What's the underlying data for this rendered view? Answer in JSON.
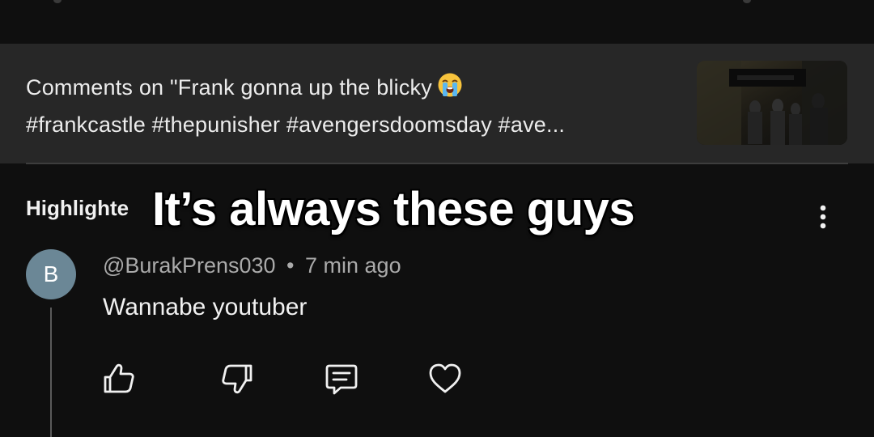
{
  "video": {
    "comments_title_line1": "Comments on \"Frank gonna up the blicky",
    "comments_title_line2": "#frankcastle #thepunisher #avengersdoomsday #ave...",
    "emoji_name": "loudly-crying-face-emoji"
  },
  "section": {
    "label": "Highlighte"
  },
  "overlay": {
    "caption": "It’s always these guys"
  },
  "comment": {
    "avatar_letter": "B",
    "author": "@BurakPrens030",
    "separator": "•",
    "time": "7 min ago",
    "text": "Wannabe youtuber",
    "avatar_color": "#6b8796"
  },
  "actions": {
    "icons": [
      "thumbs-up-icon",
      "thumbs-down-icon",
      "reply-icon",
      "heart-icon"
    ]
  },
  "menu": {
    "icon": "more-vert-icon"
  }
}
